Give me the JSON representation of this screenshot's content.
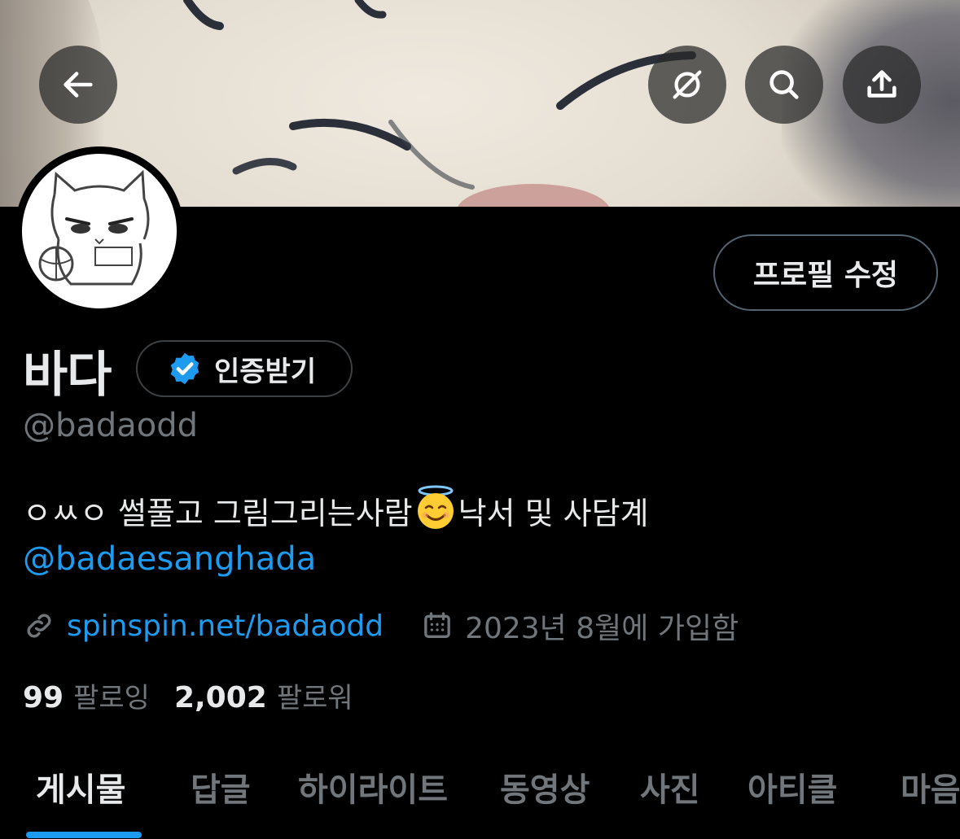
{
  "profile": {
    "name": "바다",
    "verify_label": "인증받기",
    "handle": "@badaodd",
    "bio_text_1": "ㅇㅆㅇ 썰풀고 그림그리는사람",
    "bio_emoji": "smiling-face-with-halo",
    "bio_text_2": "낙서 및 사담계",
    "bio_mention": "@badaesanghada",
    "website": "spinspin.net/badaodd",
    "joined": "2023년 8월에 가입함",
    "following_count": "99",
    "following_label": "팔로잉",
    "followers_count": "2,002",
    "followers_label": "팔로워"
  },
  "header": {
    "back_icon": "arrow-left-icon",
    "grok_icon": "grok-icon",
    "search_icon": "search-icon",
    "share_icon": "share-icon"
  },
  "actions": {
    "edit_profile_label": "프로필 수정"
  },
  "tabs": [
    {
      "label": "게시물",
      "active": true
    },
    {
      "label": "답글",
      "active": false
    },
    {
      "label": "하이라이트",
      "active": false
    },
    {
      "label": "동영상",
      "active": false
    },
    {
      "label": "사진",
      "active": false
    },
    {
      "label": "아티클",
      "active": false
    },
    {
      "label": "마음",
      "active": false
    }
  ],
  "colors": {
    "background": "#000000",
    "text_primary": "#e7e9ea",
    "text_secondary": "#71767b",
    "link": "#1d9bf0",
    "verified_badge": "#1d9bf0"
  }
}
